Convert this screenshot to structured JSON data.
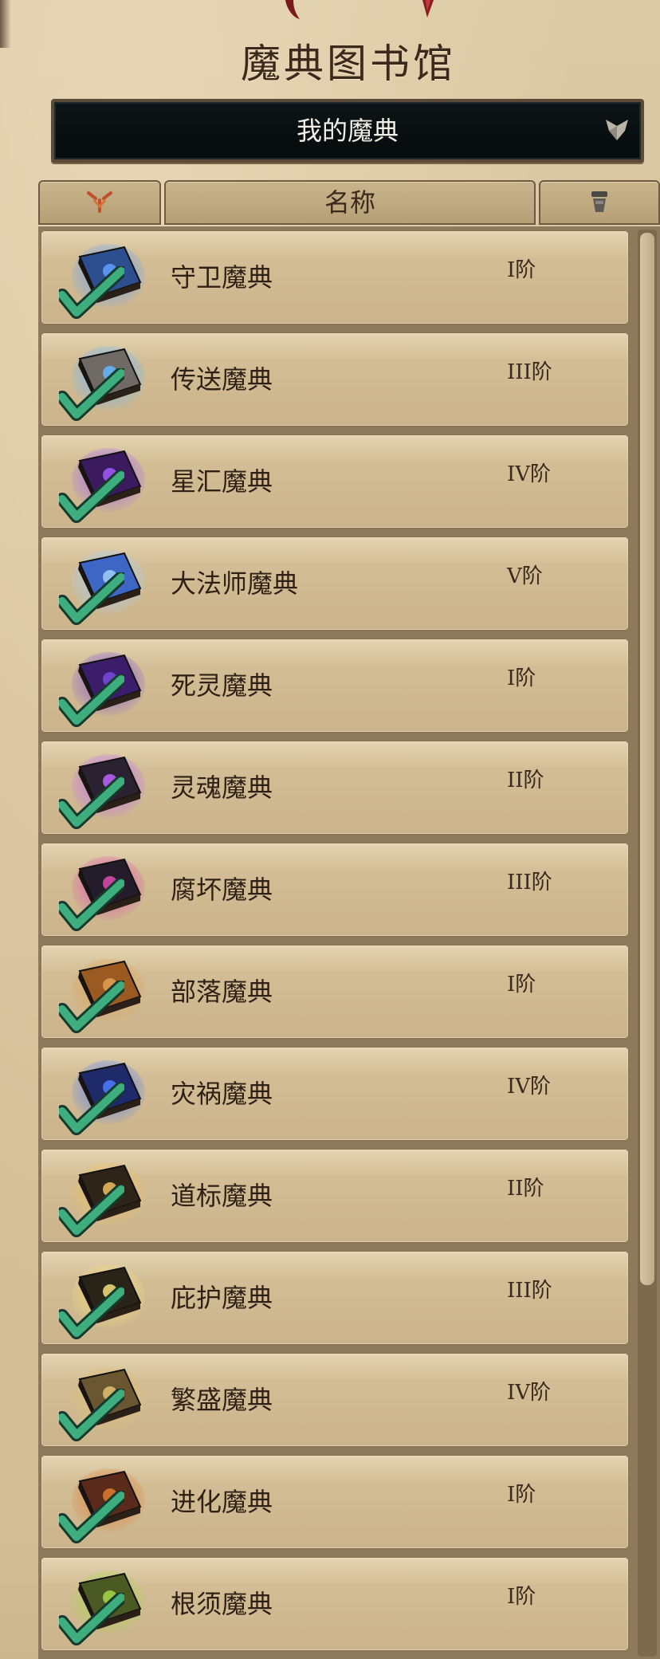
{
  "page": {
    "title": "魔典图书馆"
  },
  "dropdown": {
    "selected": "我的魔典",
    "icon": "chevron-down-icon"
  },
  "table_header": {
    "sort_icon": "sort-icon",
    "name_label": "名称",
    "filter_icon": "filter-icon"
  },
  "colors": {
    "check": "#3fae7f",
    "parchment": "#d6c29c",
    "row": "#cdb68d",
    "dark_panel": "#0a1012"
  },
  "grimoires": [
    {
      "name": "守卫魔典",
      "tier": "I阶",
      "owned": true,
      "icon": "guardian-grimoire-icon",
      "color": "#2d4f8f",
      "glow": "#5fa0ff"
    },
    {
      "name": "传送魔典",
      "tier": "III阶",
      "owned": true,
      "icon": "teleport-grimoire-icon",
      "color": "#6f6a66",
      "glow": "#63b7ff"
    },
    {
      "name": "星汇魔典",
      "tier": "IV阶",
      "owned": true,
      "icon": "astral-grimoire-icon",
      "color": "#3c1a5e",
      "glow": "#a15bff"
    },
    {
      "name": "大法师魔典",
      "tier": "V阶",
      "owned": true,
      "icon": "archmage-grimoire-icon",
      "color": "#3e66c4",
      "glow": "#9fd0ff"
    },
    {
      "name": "死灵魔典",
      "tier": "I阶",
      "owned": true,
      "icon": "necro-grimoire-icon",
      "color": "#3b1d6b",
      "glow": "#7a4ae0"
    },
    {
      "name": "灵魂魔典",
      "tier": "II阶",
      "owned": true,
      "icon": "soul-grimoire-icon",
      "color": "#2a2230",
      "glow": "#c062ff"
    },
    {
      "name": "腐坏魔典",
      "tier": "III阶",
      "owned": true,
      "icon": "decay-grimoire-icon",
      "color": "#241c2a",
      "glow": "#e04ab0"
    },
    {
      "name": "部落魔典",
      "tier": "I阶",
      "owned": true,
      "icon": "tribe-grimoire-icon",
      "color": "#9a5a22",
      "glow": "#e0a050"
    },
    {
      "name": "灾祸魔典",
      "tier": "IV阶",
      "owned": true,
      "icon": "calamity-grimoire-icon",
      "color": "#1e2a6a",
      "glow": "#4c7dff"
    },
    {
      "name": "道标魔典",
      "tier": "II阶",
      "owned": true,
      "icon": "beacon-grimoire-icon",
      "color": "#2e2418",
      "glow": "#f0c060"
    },
    {
      "name": "庇护魔典",
      "tier": "III阶",
      "owned": true,
      "icon": "sanctuary-grimoire-icon",
      "color": "#2a2418",
      "glow": "#f4e07a"
    },
    {
      "name": "繁盛魔典",
      "tier": "IV阶",
      "owned": true,
      "icon": "prosperity-grimoire-icon",
      "color": "#6a5630",
      "glow": "#e0c070"
    },
    {
      "name": "进化魔典",
      "tier": "I阶",
      "owned": true,
      "icon": "evolution-grimoire-icon",
      "color": "#5a2a1a",
      "glow": "#e07a30"
    },
    {
      "name": "根须魔典",
      "tier": "I阶",
      "owned": true,
      "icon": "roots-grimoire-icon",
      "color": "#4a5a22",
      "glow": "#a6d84a"
    }
  ]
}
